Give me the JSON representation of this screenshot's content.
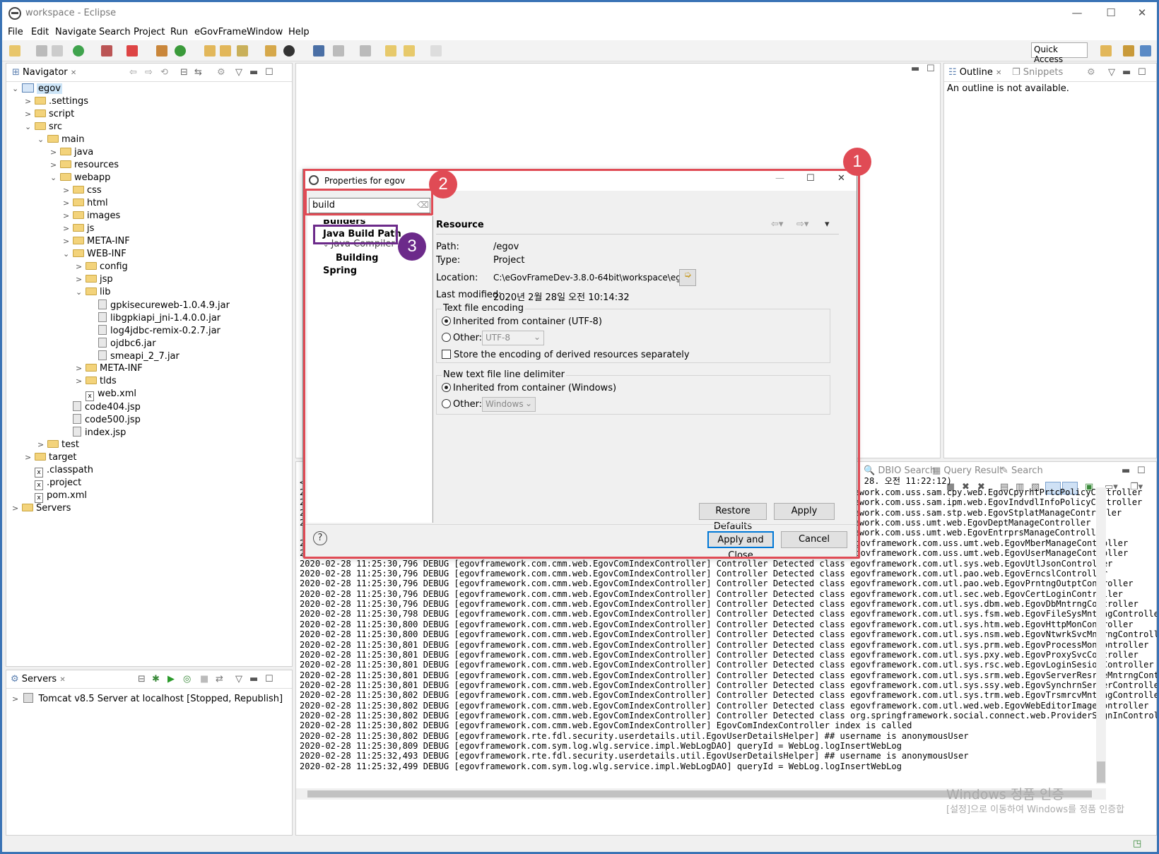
{
  "window": {
    "title": "workspace - Eclipse"
  },
  "menu": [
    "File",
    "Edit",
    "Navigate",
    "Search",
    "Project",
    "Run",
    "eGovFrame",
    "Window",
    "Help"
  ],
  "quick_access": "Quick Access",
  "navigator": {
    "tab": "Navigator",
    "items": [
      {
        "label": "egov",
        "depth": 0,
        "exp": "v",
        "icon": "proj"
      },
      {
        "label": ".settings",
        "depth": 1,
        "exp": ">",
        "icon": "fold"
      },
      {
        "label": "script",
        "depth": 1,
        "exp": ">",
        "icon": "fold"
      },
      {
        "label": "src",
        "depth": 1,
        "exp": "v",
        "icon": "fold"
      },
      {
        "label": "main",
        "depth": 2,
        "exp": "v",
        "icon": "fold"
      },
      {
        "label": "java",
        "depth": 3,
        "exp": ">",
        "icon": "fold"
      },
      {
        "label": "resources",
        "depth": 3,
        "exp": ">",
        "icon": "fold"
      },
      {
        "label": "webapp",
        "depth": 3,
        "exp": "v",
        "icon": "fold"
      },
      {
        "label": "css",
        "depth": 4,
        "exp": ">",
        "icon": "fold"
      },
      {
        "label": "html",
        "depth": 4,
        "exp": ">",
        "icon": "fold"
      },
      {
        "label": "images",
        "depth": 4,
        "exp": ">",
        "icon": "fold"
      },
      {
        "label": "js",
        "depth": 4,
        "exp": ">",
        "icon": "fold"
      },
      {
        "label": "META-INF",
        "depth": 4,
        "exp": ">",
        "icon": "fold"
      },
      {
        "label": "WEB-INF",
        "depth": 4,
        "exp": "v",
        "icon": "fold"
      },
      {
        "label": "config",
        "depth": 5,
        "exp": ">",
        "icon": "fold"
      },
      {
        "label": "jsp",
        "depth": 5,
        "exp": ">",
        "icon": "fold"
      },
      {
        "label": "lib",
        "depth": 5,
        "exp": "v",
        "icon": "fold"
      },
      {
        "label": "gpkisecureweb-1.0.4.9.jar",
        "depth": 6,
        "exp": "",
        "icon": "jar"
      },
      {
        "label": "libgpkiapi_jni-1.4.0.0.jar",
        "depth": 6,
        "exp": "",
        "icon": "jar"
      },
      {
        "label": "log4jdbc-remix-0.2.7.jar",
        "depth": 6,
        "exp": "",
        "icon": "jar"
      },
      {
        "label": "ojdbc6.jar",
        "depth": 6,
        "exp": "",
        "icon": "jar"
      },
      {
        "label": "smeapi_2_7.jar",
        "depth": 6,
        "exp": "",
        "icon": "jar"
      },
      {
        "label": "META-INF",
        "depth": 5,
        "exp": ">",
        "icon": "fold"
      },
      {
        "label": "tlds",
        "depth": 5,
        "exp": ">",
        "icon": "fold"
      },
      {
        "label": "web.xml",
        "depth": 5,
        "exp": "",
        "icon": "xfile"
      },
      {
        "label": "code404.jsp",
        "depth": 4,
        "exp": "",
        "icon": "jar"
      },
      {
        "label": "code500.jsp",
        "depth": 4,
        "exp": "",
        "icon": "jar"
      },
      {
        "label": "index.jsp",
        "depth": 4,
        "exp": "",
        "icon": "jar"
      },
      {
        "label": "test",
        "depth": 2,
        "exp": ">",
        "icon": "fold"
      },
      {
        "label": "target",
        "depth": 1,
        "exp": ">",
        "icon": "fold"
      },
      {
        "label": ".classpath",
        "depth": 1,
        "exp": "",
        "icon": "xfile"
      },
      {
        "label": ".project",
        "depth": 1,
        "exp": "",
        "icon": "xfile"
      },
      {
        "label": "pom.xml",
        "depth": 1,
        "exp": "",
        "icon": "xfile"
      },
      {
        "label": "Servers",
        "depth": 0,
        "exp": ">",
        "icon": "fold"
      }
    ]
  },
  "servers": {
    "tab": "Servers",
    "item": "Tomcat v8.5 Server at localhost  [Stopped, Republish]"
  },
  "outline": {
    "tab": "Outline",
    "tab2": "Snippets",
    "message": "An outline is not available."
  },
  "console": {
    "tabs": [
      "DBIO Search",
      "Query Result",
      "Search"
    ],
    "header": "0. 2. 28. 오전 11:22:12)",
    "right_lines": [
      "amework.com.uss.sam.cpy.web.EgovCpyrhtPrtcPolicyController",
      "amework.com.uss.sam.ipm.web.EgovIndvdlInfoPolicyController",
      "amework.com.uss.sam.stp.web.EgovStplatManageController",
      "amework.com.uss.umt.web.EgovDeptManageController",
      "amework.com.uss.umt.web.EgovEntrprsManageController"
    ],
    "lines": [
      "2020-02-28 11:25:30,796 DEBUG [egovframework.com.cmm.web.EgovComIndexController] Controller Detected class egovframework.com.uss.umt.web.EgovMberManageController",
      "2020-02-28 11:25:30,796 DEBUG [egovframework.com.cmm.web.EgovComIndexController] Controller Detected class egovframework.com.uss.umt.web.EgovUserManageController",
      "2020-02-28 11:25:30,796 DEBUG [egovframework.com.cmm.web.EgovComIndexController] Controller Detected class egovframework.com.utl.sys.web.EgovUtlJsonController",
      "2020-02-28 11:25:30,796 DEBUG [egovframework.com.cmm.web.EgovComIndexController] Controller Detected class egovframework.com.utl.pao.web.EgovErncslController",
      "2020-02-28 11:25:30,796 DEBUG [egovframework.com.cmm.web.EgovComIndexController] Controller Detected class egovframework.com.utl.pao.web.EgovPrntngOutptController",
      "2020-02-28 11:25:30,796 DEBUG [egovframework.com.cmm.web.EgovComIndexController] Controller Detected class egovframework.com.utl.sec.web.EgovCertLoginController",
      "2020-02-28 11:25:30,796 DEBUG [egovframework.com.cmm.web.EgovComIndexController] Controller Detected class egovframework.com.utl.sys.dbm.web.EgovDbMntrngController",
      "2020-02-28 11:25:30,798 DEBUG [egovframework.com.cmm.web.EgovComIndexController] Controller Detected class egovframework.com.utl.sys.fsm.web.EgovFileSysMntrngController",
      "2020-02-28 11:25:30,800 DEBUG [egovframework.com.cmm.web.EgovComIndexController] Controller Detected class egovframework.com.utl.sys.htm.web.EgovHttpMonController",
      "2020-02-28 11:25:30,800 DEBUG [egovframework.com.cmm.web.EgovComIndexController] Controller Detected class egovframework.com.utl.sys.nsm.web.EgovNtwrkSvcMntrngController",
      "2020-02-28 11:25:30,801 DEBUG [egovframework.com.cmm.web.EgovComIndexController] Controller Detected class egovframework.com.utl.sys.prm.web.EgovProcessMonController",
      "2020-02-28 11:25:30,801 DEBUG [egovframework.com.cmm.web.EgovComIndexController] Controller Detected class egovframework.com.utl.sys.pxy.web.EgovProxySvcController",
      "2020-02-28 11:25:30,801 DEBUG [egovframework.com.cmm.web.EgovComIndexController] Controller Detected class egovframework.com.utl.sys.rsc.web.EgovLoginSesionController",
      "2020-02-28 11:25:30,801 DEBUG [egovframework.com.cmm.web.EgovComIndexController] Controller Detected class egovframework.com.utl.sys.srm.web.EgovServerResrceMntrngControll",
      "2020-02-28 11:25:30,801 DEBUG [egovframework.com.cmm.web.EgovComIndexController] Controller Detected class egovframework.com.utl.sys.ssy.web.EgovSynchrnServerController",
      "2020-02-28 11:25:30,802 DEBUG [egovframework.com.cmm.web.EgovComIndexController] Controller Detected class egovframework.com.utl.sys.trm.web.EgovTrsmrcvMntrngController",
      "2020-02-28 11:25:30,802 DEBUG [egovframework.com.cmm.web.EgovComIndexController] Controller Detected class egovframework.com.utl.wed.web.EgovWebEditorImageController",
      "2020-02-28 11:25:30,802 DEBUG [egovframework.com.cmm.web.EgovComIndexController] Controller Detected class org.springframework.social.connect.web.ProviderSignInController",
      "2020-02-28 11:25:30,802 DEBUG [egovframework.com.cmm.web.EgovComIndexController] EgovComIndexController index is called",
      "2020-02-28 11:25:30,802 DEBUG [egovframework.rte.fdl.security.userdetails.util.EgovUserDetailsHelper] ## username is anonymousUser",
      "2020-02-28 11:25:30,809 DEBUG [egovframework.com.sym.log.wlg.service.impl.WebLogDAO] queryId = WebLog.logInsertWebLog",
      "2020-02-28 11:25:32,493 DEBUG [egovframework.rte.fdl.security.userdetails.util.EgovUserDetailsHelper] ## username is anonymousUser",
      "2020-02-28 11:25:32,499 DEBUG [egovframework.com.sym.log.wlg.service.impl.WebLogDAO] queryId = WebLog.logInsertWebLog"
    ]
  },
  "watermark": {
    "line1": "Windows 정품 인증",
    "line2": "[설정]으로 이동하여 Windows를 정품 인증합"
  },
  "dialog": {
    "title": "Properties for egov",
    "filter": "build",
    "tree": [
      "Builders",
      "Java Build Path",
      "Java Compiler",
      "Building",
      "Spring"
    ],
    "heading": "Resource",
    "path_label": "Path:",
    "path": "/egov",
    "type_label": "Type:",
    "type": "Project",
    "location_label": "Location:",
    "location": "C:\\eGovFrameDev-3.8.0-64bit\\workspace\\egov",
    "modified_label": "Last modified:",
    "modified": "2020년 2월 28일 오전 10:14:32",
    "encoding_group": "Text file encoding",
    "enc_inherited": "Inherited from container (UTF-8)",
    "enc_other": "Other:",
    "enc_value": "UTF-8",
    "store_derived": "Store the encoding of derived resources separately",
    "delim_group": "New text file line delimiter",
    "delim_inherited": "Inherited from container (Windows)",
    "delim_other": "Other:",
    "delim_value": "Windows",
    "restore": "Restore Defaults",
    "apply": "Apply",
    "apply_close": "Apply and Close",
    "cancel": "Cancel"
  },
  "annotations": [
    "1",
    "2",
    "3"
  ],
  "colors": {
    "highlight_red": "#e04b55",
    "badge_purple": "#6c2a8a",
    "frame_blue": "#3a73b5"
  }
}
